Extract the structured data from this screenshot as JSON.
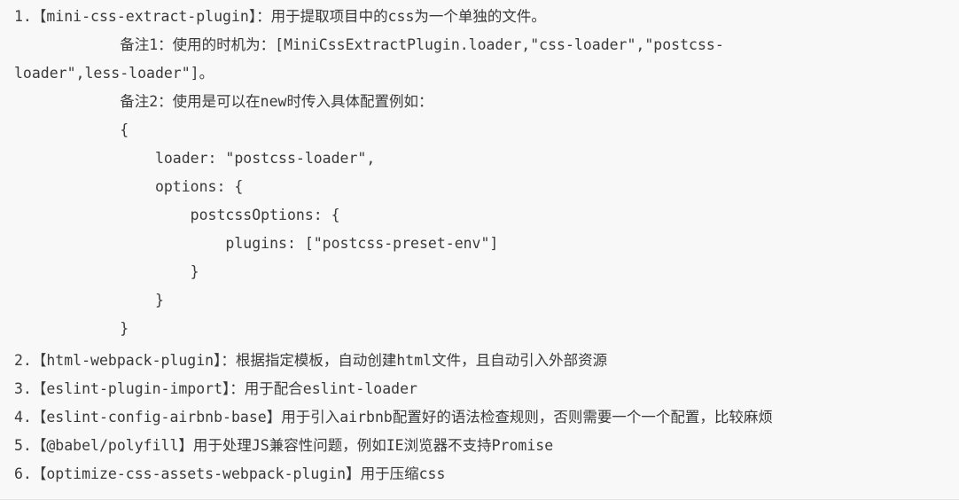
{
  "lines": [
    "1.【mini-css-extract-plugin】：用于提取项目中的css为一个单独的文件。",
    "            备注1：使用的时机为：[MiniCssExtractPlugin.loader,\"css-loader\",\"postcss-",
    "loader\",less-loader\"]。",
    "            备注2：使用是可以在new时传入具体配置例如：",
    "            {",
    "                loader: \"postcss-loader\",",
    "                options: {",
    "                    postcssOptions: {",
    "                        plugins: [\"postcss-preset-env\"]",
    "                    }",
    "                }",
    "            }",
    "2.【html-webpack-plugin】：根据指定模板，自动创建html文件，且自动引入外部资源",
    "3.【eslint-plugin-import】：用于配合eslint-loader",
    "4.【eslint-config-airbnb-base】用于引入airbnb配置好的语法检查规则，否则需要一个一个配置，比较麻烦",
    "5.【@babel/polyfill】用于处理JS兼容性问题，例如IE浏览器不支持Promise",
    "6.【optimize-css-assets-webpack-plugin】用于压缩css"
  ]
}
